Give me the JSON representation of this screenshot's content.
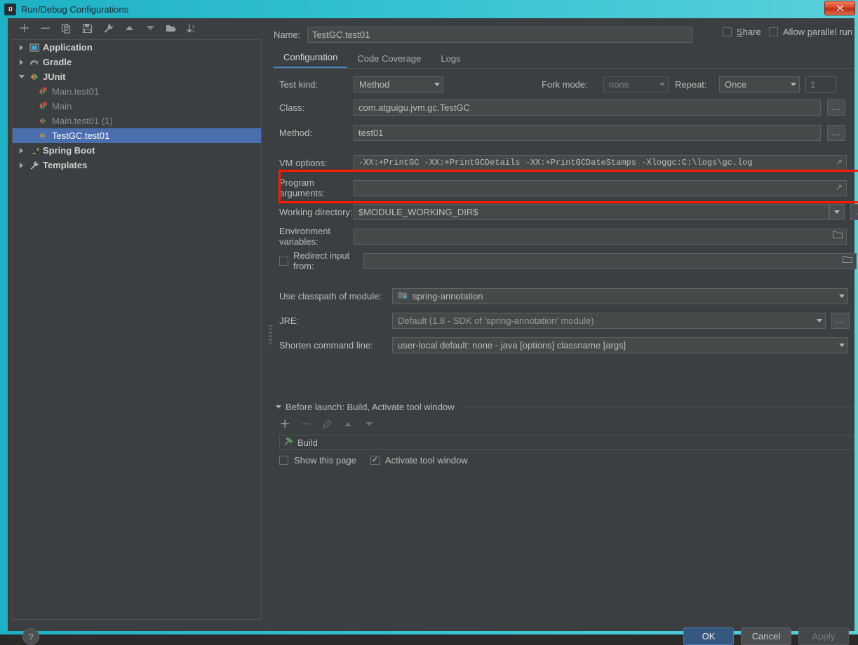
{
  "window": {
    "title": "Run/Debug Configurations",
    "logo_text": "IJ",
    "close_label": "x"
  },
  "toolbar": {
    "items": [
      {
        "name": "add-configuration-button",
        "icon": "plus-icon"
      },
      {
        "name": "remove-configuration-button",
        "icon": "minus-icon"
      },
      {
        "name": "copy-configuration-button",
        "icon": "copy-icon"
      },
      {
        "name": "save-configuration-button",
        "icon": "save-icon"
      },
      {
        "name": "edit-templates-button",
        "icon": "wrench-icon"
      },
      {
        "name": "move-up-button",
        "icon": "arrow-up-icon"
      },
      {
        "name": "move-down-button",
        "icon": "arrow-down-icon"
      },
      {
        "name": "create-folder-button",
        "icon": "folder-add-icon"
      },
      {
        "name": "sort-configurations-button",
        "icon": "sort-az-icon"
      }
    ]
  },
  "tree": {
    "items": [
      {
        "label": "Application",
        "level": 0,
        "twisty": "collapsed",
        "icon": "application-icon",
        "selected": false
      },
      {
        "label": "Gradle",
        "level": 0,
        "twisty": "collapsed",
        "icon": "gradle-icon",
        "selected": false
      },
      {
        "label": "JUnit",
        "level": 0,
        "twisty": "expanded",
        "icon": "junit-icon",
        "selected": false
      },
      {
        "label": "Main.test01",
        "level": 1,
        "twisty": "none",
        "icon": "junit-invalid-icon",
        "selected": false
      },
      {
        "label": "Main",
        "level": 1,
        "twisty": "none",
        "icon": "junit-invalid-icon",
        "selected": false
      },
      {
        "label": "Main.test01 (1)",
        "level": 1,
        "twisty": "none",
        "icon": "junit-run-icon",
        "selected": false
      },
      {
        "label": "TestGC.test01",
        "level": 1,
        "twisty": "none",
        "icon": "junit-run-icon",
        "selected": true
      },
      {
        "label": "Spring Boot",
        "level": 0,
        "twisty": "collapsed",
        "icon": "spring-boot-icon",
        "selected": false
      },
      {
        "label": "Templates",
        "level": 0,
        "twisty": "collapsed",
        "icon": "templates-icon",
        "selected": false
      }
    ]
  },
  "form": {
    "name_label": "Name:",
    "name_value": "TestGC.test01",
    "share_label": "Share",
    "share_checked": false,
    "parallel_label": "Allow parallel run",
    "parallel_checked": false,
    "tabs": [
      {
        "label": "Configuration",
        "active": true
      },
      {
        "label": "Code Coverage",
        "active": false
      },
      {
        "label": "Logs",
        "active": false
      }
    ],
    "test_kind_label": "Test kind:",
    "test_kind_value": "Method",
    "fork_mode_label": "Fork mode:",
    "fork_mode_value": "none",
    "repeat_label": "Repeat:",
    "repeat_value": "Once",
    "repeat_count": "1",
    "class_label": "Class:",
    "class_value": "com.atguigu.jvm.gc.TestGC",
    "method_label": "Method:",
    "method_value": "test01",
    "vm_options_label": "VM options:",
    "vm_options_value": "-XX:+PrintGC -XX:+PrintGCDetails -XX:+PrintGCDateStamps -Xloggc:C:\\logs\\gc.log",
    "program_args_label": "Program arguments:",
    "program_args_value": "",
    "working_dir_label": "Working directory:",
    "working_dir_value": "$MODULE_WORKING_DIR$",
    "env_vars_label": "Environment variables:",
    "env_vars_value": "",
    "redirect_label": "Redirect input from:",
    "redirect_checked": false,
    "redirect_value": "",
    "classpath_label": "Use classpath of module:",
    "classpath_value": "spring-annotation",
    "jre_label": "JRE:",
    "jre_value": "Default (1.8 - SDK of 'spring-annotation' module)",
    "shorten_label": "Shorten command line:",
    "shorten_value": "user-local default: none - java [options] classname [args]",
    "browse_label": "..."
  },
  "before_launch": {
    "header": "Before launch: Build, Activate tool window",
    "tasks": [
      {
        "label": "Build",
        "icon": "build-hammer-icon"
      }
    ],
    "toolbar": [
      {
        "name": "add-task-button",
        "icon": "plus-icon",
        "enabled": true
      },
      {
        "name": "remove-task-button",
        "icon": "minus-icon",
        "enabled": false
      },
      {
        "name": "edit-task-button",
        "icon": "pencil-icon",
        "enabled": false
      },
      {
        "name": "move-task-up-button",
        "icon": "arrow-up-icon",
        "enabled": false
      },
      {
        "name": "move-task-down-button",
        "icon": "arrow-down-icon",
        "enabled": false
      }
    ],
    "show_page_label": "Show this page",
    "show_page_checked": false,
    "activate_window_label": "Activate tool window",
    "activate_window_checked": true
  },
  "buttons": {
    "help": "?",
    "ok": "OK",
    "cancel": "Cancel",
    "apply": "Apply"
  },
  "colors": {
    "title_bar": "#2fc0cf",
    "dialog_bg": "#3c3f41",
    "selection": "#4b6eaf",
    "accent_tab": "#4a88c7",
    "highlight_box": "#ff1a00",
    "ok_button": "#365880"
  }
}
